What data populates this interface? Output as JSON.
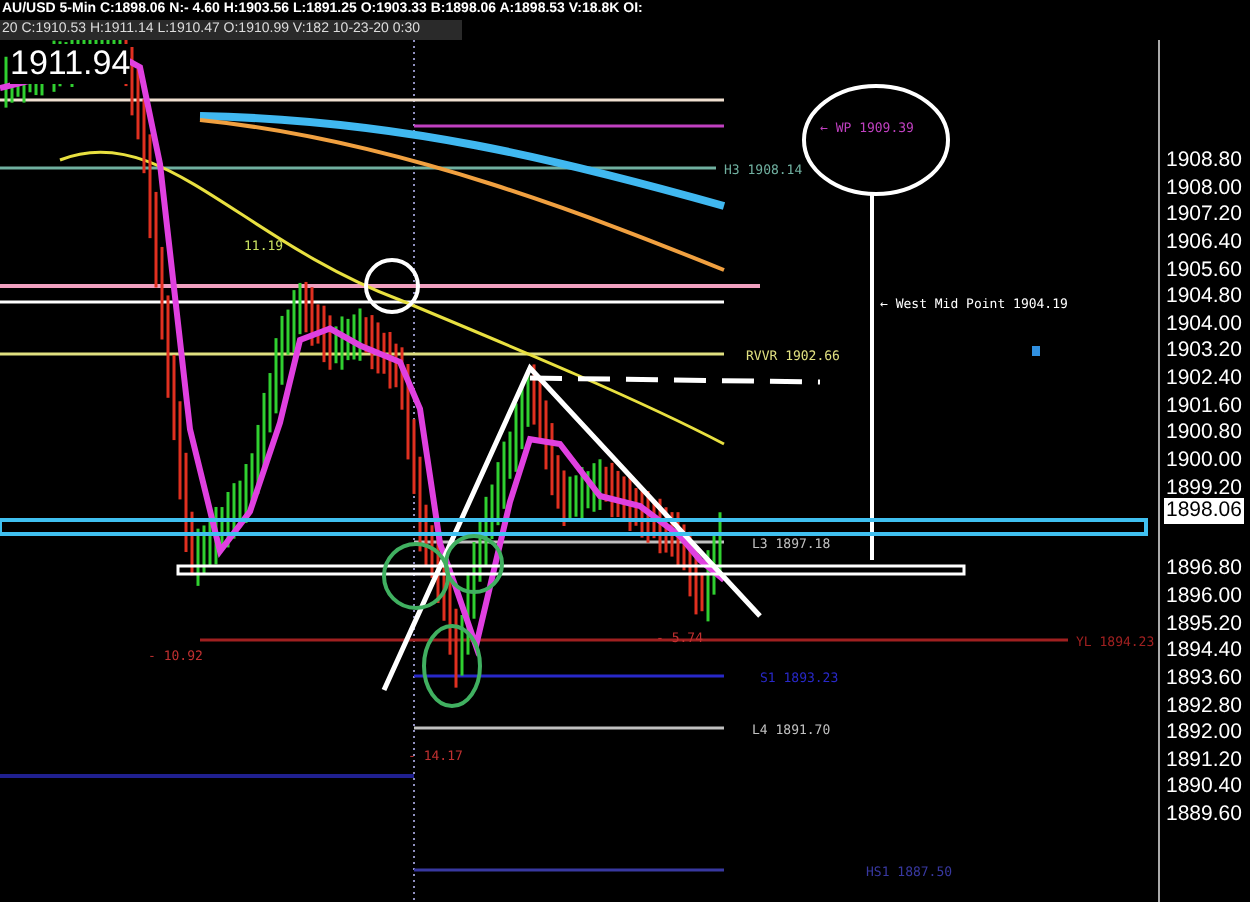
{
  "header": {
    "quote": "AU/USD 5-Min C:1898.06 N:- 4.60 H:1903.56 L:1891.25 O:1903.33 B:1898.06 A:1898.53 V:18.8K OI:",
    "bar_info": "20 C:1910.53 H:1911.14 L:1910.47 O:1910.99 V:182 10-23-20 0:30"
  },
  "chart": {
    "cursor_price": "1911.94",
    "levels": [
      {
        "label": "← WP 1909.39",
        "color": "#c040c0"
      },
      {
        "label": "H3 1908.14",
        "color": "#70b0a0"
      },
      {
        "label": "← West Mid Point 1904.19",
        "color": "#ffffff"
      },
      {
        "label": "RVVR 1902.66",
        "color": "#e0e080"
      },
      {
        "label": "L3 1897.18",
        "color": "#c0c0c0"
      },
      {
        "label": "YL 1894.23",
        "color": "#a02020"
      },
      {
        "label": "S1 1893.23",
        "color": "#2828c8"
      },
      {
        "label": "L4 1891.70",
        "color": "#c0c0c0"
      },
      {
        "label": "HS1 1887.50",
        "color": "#3838a0"
      }
    ],
    "swing_labels": [
      {
        "text": "11.19",
        "color": "#c8e060"
      },
      {
        "text": "- 10.92",
        "color": "#c03030"
      },
      {
        "text": "- 5.74",
        "color": "#c03030"
      },
      {
        "text": "- 14.17",
        "color": "#c03030"
      }
    ],
    "axis": {
      "ticks": [
        "1908.80",
        "1908.00",
        "1907.20",
        "1906.40",
        "1905.60",
        "1904.80",
        "1904.00",
        "1903.20",
        "1902.40",
        "1901.60",
        "1900.80",
        "1900.00",
        "1899.20",
        "1896.80",
        "1896.00",
        "1895.20",
        "1894.40",
        "1893.60",
        "1892.80",
        "1892.00",
        "1891.20",
        "1890.40",
        "1889.60"
      ],
      "last_price": "1898.06"
    }
  }
}
